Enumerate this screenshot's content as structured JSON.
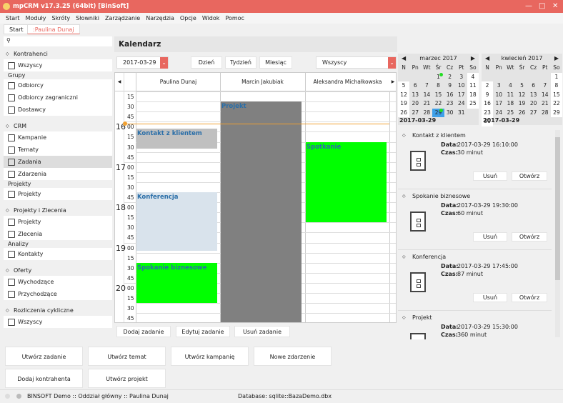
{
  "window": {
    "title": "mpCRM v17.3.25 (64bit) [BinSoft]",
    "min": "—",
    "max": "□",
    "close": "✕"
  },
  "menu": [
    "Start",
    "Moduły",
    "Skróty",
    "Słowniki",
    "Zarządzanie",
    "Narzędzia",
    "Opcje",
    "Widok",
    "Pomoc"
  ],
  "tabs": [
    {
      "label": "Start"
    },
    {
      "label": ":Paulina Dunaj"
    }
  ],
  "sidebar": [
    {
      "type": "sec",
      "label": "Kontrahenci"
    },
    {
      "type": "item",
      "label": "Wszyscy"
    },
    {
      "type": "grp",
      "label": "Grupy"
    },
    {
      "type": "item",
      "label": "Odbiorcy"
    },
    {
      "type": "item",
      "label": "Odbiorcy zagraniczni"
    },
    {
      "type": "item",
      "label": "Dostawcy"
    },
    {
      "type": "gap"
    },
    {
      "type": "sec",
      "label": "CRM"
    },
    {
      "type": "item",
      "label": "Kampanie"
    },
    {
      "type": "item",
      "label": "Tematy"
    },
    {
      "type": "item",
      "label": "Zadania",
      "selected": true
    },
    {
      "type": "item",
      "label": "Zdarzenia"
    },
    {
      "type": "grp",
      "label": "Projekty"
    },
    {
      "type": "item",
      "label": "Projekty"
    },
    {
      "type": "gap"
    },
    {
      "type": "sec",
      "label": "Projekty i Zlecenia"
    },
    {
      "type": "item",
      "label": "Projekty"
    },
    {
      "type": "item",
      "label": "Zlecenia"
    },
    {
      "type": "grp",
      "label": "Analizy"
    },
    {
      "type": "item",
      "label": "Kontakty"
    },
    {
      "type": "gap"
    },
    {
      "type": "sec",
      "label": "Oferty"
    },
    {
      "type": "item",
      "label": "Wychodzące"
    },
    {
      "type": "item",
      "label": "Przychodzące"
    },
    {
      "type": "gap"
    },
    {
      "type": "sec",
      "label": "Rozliczenia cykliczne"
    },
    {
      "type": "item",
      "label": "Wszyscy"
    }
  ],
  "main": {
    "title": "Kalendarz",
    "date": "2017-03-29",
    "views": [
      "Dzień",
      "Tydzień",
      "Miesiąc"
    ],
    "filter": "Wszyscy",
    "columns": [
      "Paulina Dunaj",
      "Marcin Jakubiak",
      "Aleksandra Michałkowska"
    ],
    "hours": [
      "16",
      "17",
      "18",
      "19",
      "20"
    ],
    "events": [
      {
        "col": 0,
        "label": "Kontakt z klientem",
        "start": "16:10",
        "minutes": 30,
        "color": "#c0c0c0"
      },
      {
        "col": 1,
        "label": "Projekt",
        "start": "15:30",
        "minutes": 360,
        "color": "#808080"
      },
      {
        "col": 2,
        "label": "Spotkanie",
        "start": "16:30",
        "minutes": 120,
        "color": "#00ff00"
      },
      {
        "col": 0,
        "label": "Konferencja",
        "start": "17:45",
        "minutes": 87,
        "color": "#d9e3ec"
      },
      {
        "col": 0,
        "label": "Spokanie biznesowe",
        "start": "19:30",
        "minutes": 60,
        "color": "#00ff00"
      }
    ],
    "current_time": "16:03",
    "actions": [
      "Dodaj zadanie",
      "Edytuj zadanie",
      "Usuń zadanie"
    ]
  },
  "calendars": [
    {
      "month": "marzec 2017",
      "offset": 3,
      "days": 31,
      "selected": 29,
      "marked": [
        1,
        29
      ],
      "footer": "2017-03-29"
    },
    {
      "month": "kwiecień 2017",
      "offset": 6,
      "days": 30,
      "footer": "2017-03-29"
    }
  ],
  "weekdays": [
    "N",
    "Pn",
    "Wt",
    "Śr",
    "Cz",
    "Pt",
    "So"
  ],
  "event_list": {
    "date_label": "Data:",
    "time_label": "Czas:",
    "delete": "Usuń",
    "open": "Otwórz",
    "items": [
      {
        "title": "Kontakt z klientem",
        "date": "2017-03-29 16:10:00",
        "time": "30 minut"
      },
      {
        "title": "Spokanie biznesowe",
        "date": "2017-03-29 19:30:00",
        "time": "60 minut"
      },
      {
        "title": "Konferencja",
        "date": "2017-03-29 17:45:00",
        "time": "87 minut"
      },
      {
        "title": "Projekt",
        "date": "2017-03-29 15:30:00",
        "time": "360 minut"
      }
    ]
  },
  "quick": [
    "Utwórz zadanie",
    "Utwórz temat",
    "Utwórz kampanię",
    "Nowe zdarzenie",
    "Dodaj kontrahenta",
    "Utwórz projekt"
  ],
  "status": {
    "left": "BINSOFT Demo :: Oddział główny :: Paulina Dunaj",
    "db": "Database: sqlite::BazaDemo.dbx"
  },
  "accent": "#e8675f"
}
